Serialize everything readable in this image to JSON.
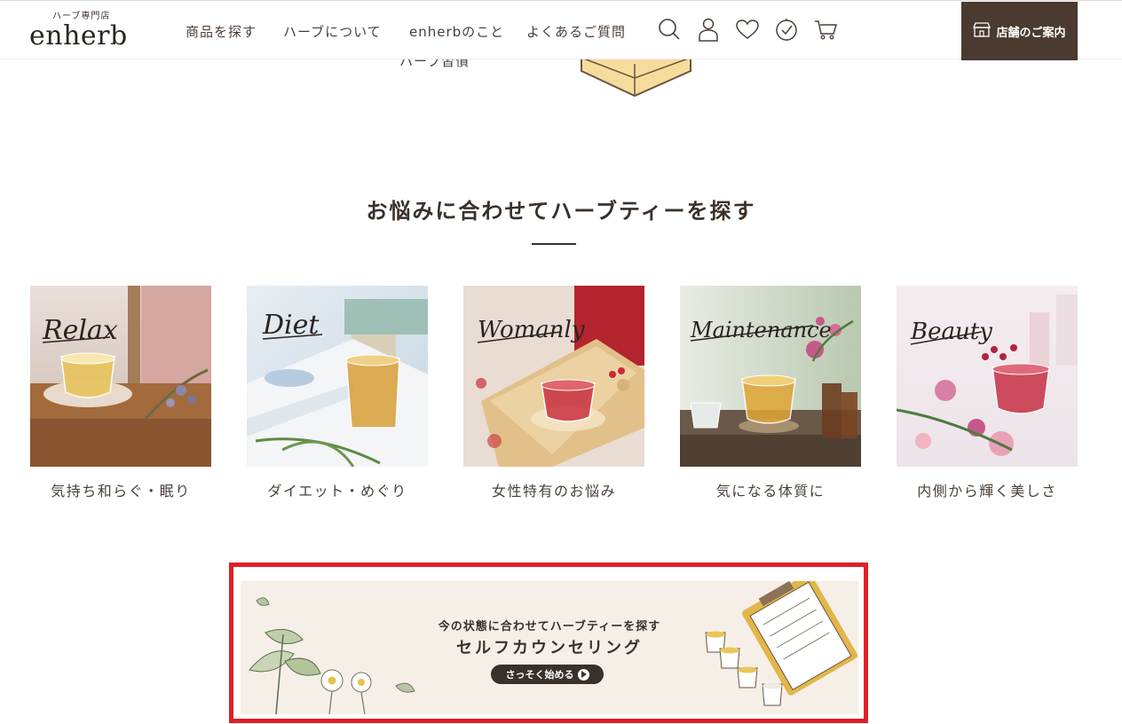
{
  "header": {
    "logo_sub": "ハーブ専門店",
    "logo_main": "enherb",
    "nav": [
      "商品を探す",
      "ハーブについて",
      "enherbのこと",
      "よくあるご質問"
    ],
    "icons": [
      "search-icon",
      "user-icon",
      "heart-icon",
      "history-icon",
      "cart-icon"
    ],
    "store_button": "店舗のご案内"
  },
  "partial": {
    "text": "ハーブ習慣"
  },
  "section": {
    "title": "お悩みに合わせてハーブティーを探す",
    "cards": [
      {
        "script": "Relax",
        "caption": "気持ち和らぐ・眠り"
      },
      {
        "script": "Diet",
        "caption": "ダイエット・めぐり"
      },
      {
        "script": "Womanly",
        "caption": "女性特有のお悩み"
      },
      {
        "script": "Maintenance",
        "caption": "気になる体質に"
      },
      {
        "script": "Beauty",
        "caption": "内側から輝く美しさ"
      }
    ]
  },
  "banner": {
    "line1": "今の状態に合わせてハーブティーを探す",
    "line2": "セルフカウンセリング",
    "button": "さっそく始める"
  },
  "colors": {
    "brand_dark": "#4a3a30",
    "highlight_red": "#e11f26",
    "banner_bg": "#f5efe8"
  }
}
